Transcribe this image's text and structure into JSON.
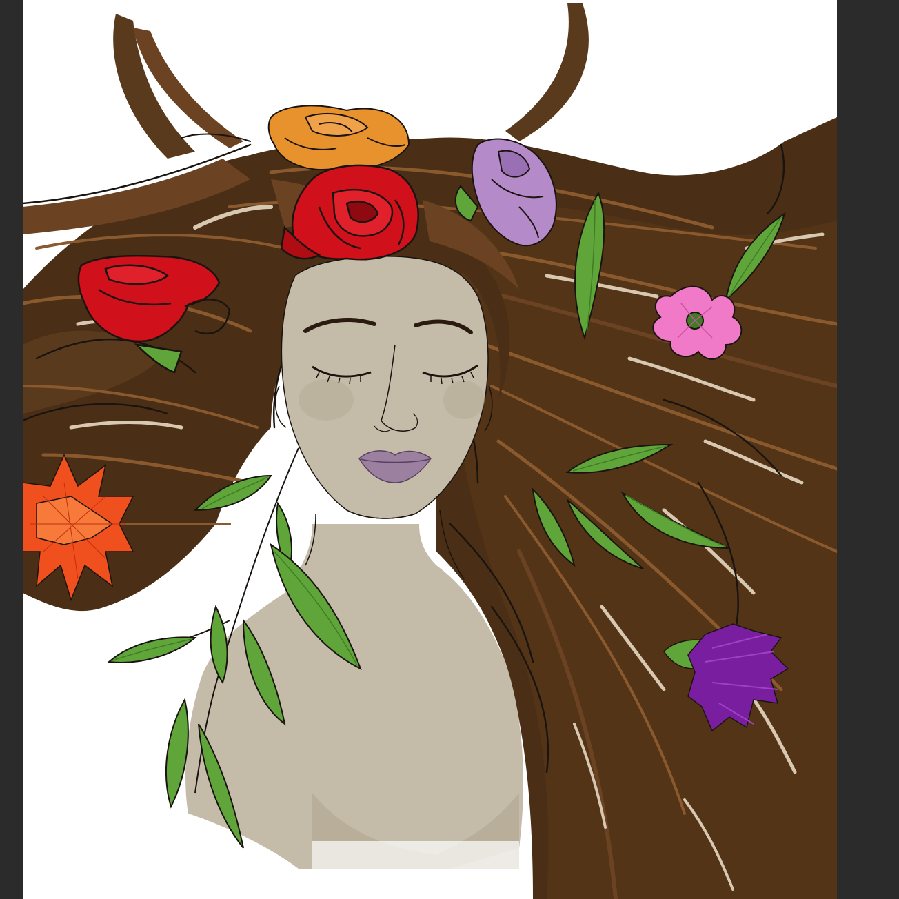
{
  "canvas": {
    "background": "#ffffff",
    "workspace_color": "#2b2b2b"
  },
  "artwork": {
    "subject": "illustrated-woman-with-flowing-hair-and-flowers",
    "palette": {
      "hair_base": "#4a2f16",
      "hair_mid": "#6b4322",
      "hair_light": "#8a5a2e",
      "hair_highlight": "#d8c8b2",
      "skin": "#c4bba9",
      "skin_shadow": "#b6ab96",
      "lips": "#9b80a0",
      "line": "#1a1410",
      "leaf": "#5fa53a",
      "leaf_dark": "#3f7d24",
      "rose_red": "#d0101a",
      "rose_dark": "#8e0a10",
      "rose_orange": "#e8922e",
      "rose_lavender": "#b48ac8",
      "flower_pink": "#f07ac8",
      "flower_orange": "#f0501e",
      "flower_purple": "#7a1ea0"
    },
    "icons": [
      "orange-rose-icon",
      "red-rose-icon",
      "lavender-rose-icon",
      "red-tulip-icon",
      "pink-flower-icon",
      "orange-spiky-flower-icon",
      "purple-flower-icon",
      "leaf-icon"
    ]
  }
}
